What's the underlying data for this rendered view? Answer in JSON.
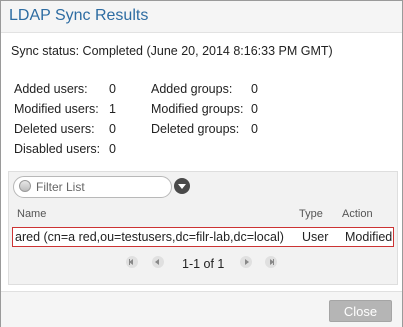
{
  "dialog": {
    "title": "LDAP Sync Results",
    "sync_status": "Sync status: Completed (June 20, 2014 8:16:33 PM GMT)"
  },
  "stats_users": [
    {
      "label": "Added users:",
      "value": "0"
    },
    {
      "label": "Modified users:",
      "value": "1"
    },
    {
      "label": "Deleted users:",
      "value": "0"
    },
    {
      "label": "Disabled users:",
      "value": "0"
    }
  ],
  "stats_groups": [
    {
      "label": "Added groups:",
      "value": "0"
    },
    {
      "label": "Modified groups:",
      "value": "0"
    },
    {
      "label": "Deleted groups:",
      "value": "0"
    }
  ],
  "filter": {
    "placeholder": "Filter List",
    "dropdown_icon": "chevron-down-circle-icon"
  },
  "table": {
    "headers": {
      "name": "Name",
      "type": "Type",
      "action": "Action"
    },
    "rows": [
      {
        "name": "ared (cn=a red,ou=testusers,dc=filr-lab,dc=local)",
        "type": "User",
        "action": "Modified"
      }
    ]
  },
  "pager": {
    "info": "1-1 of 1"
  },
  "footer": {
    "close_label": "Close"
  },
  "colors": {
    "title": "#2d6ca2",
    "highlight_border": "#cc3333",
    "close_button": "#b5b5b5"
  }
}
